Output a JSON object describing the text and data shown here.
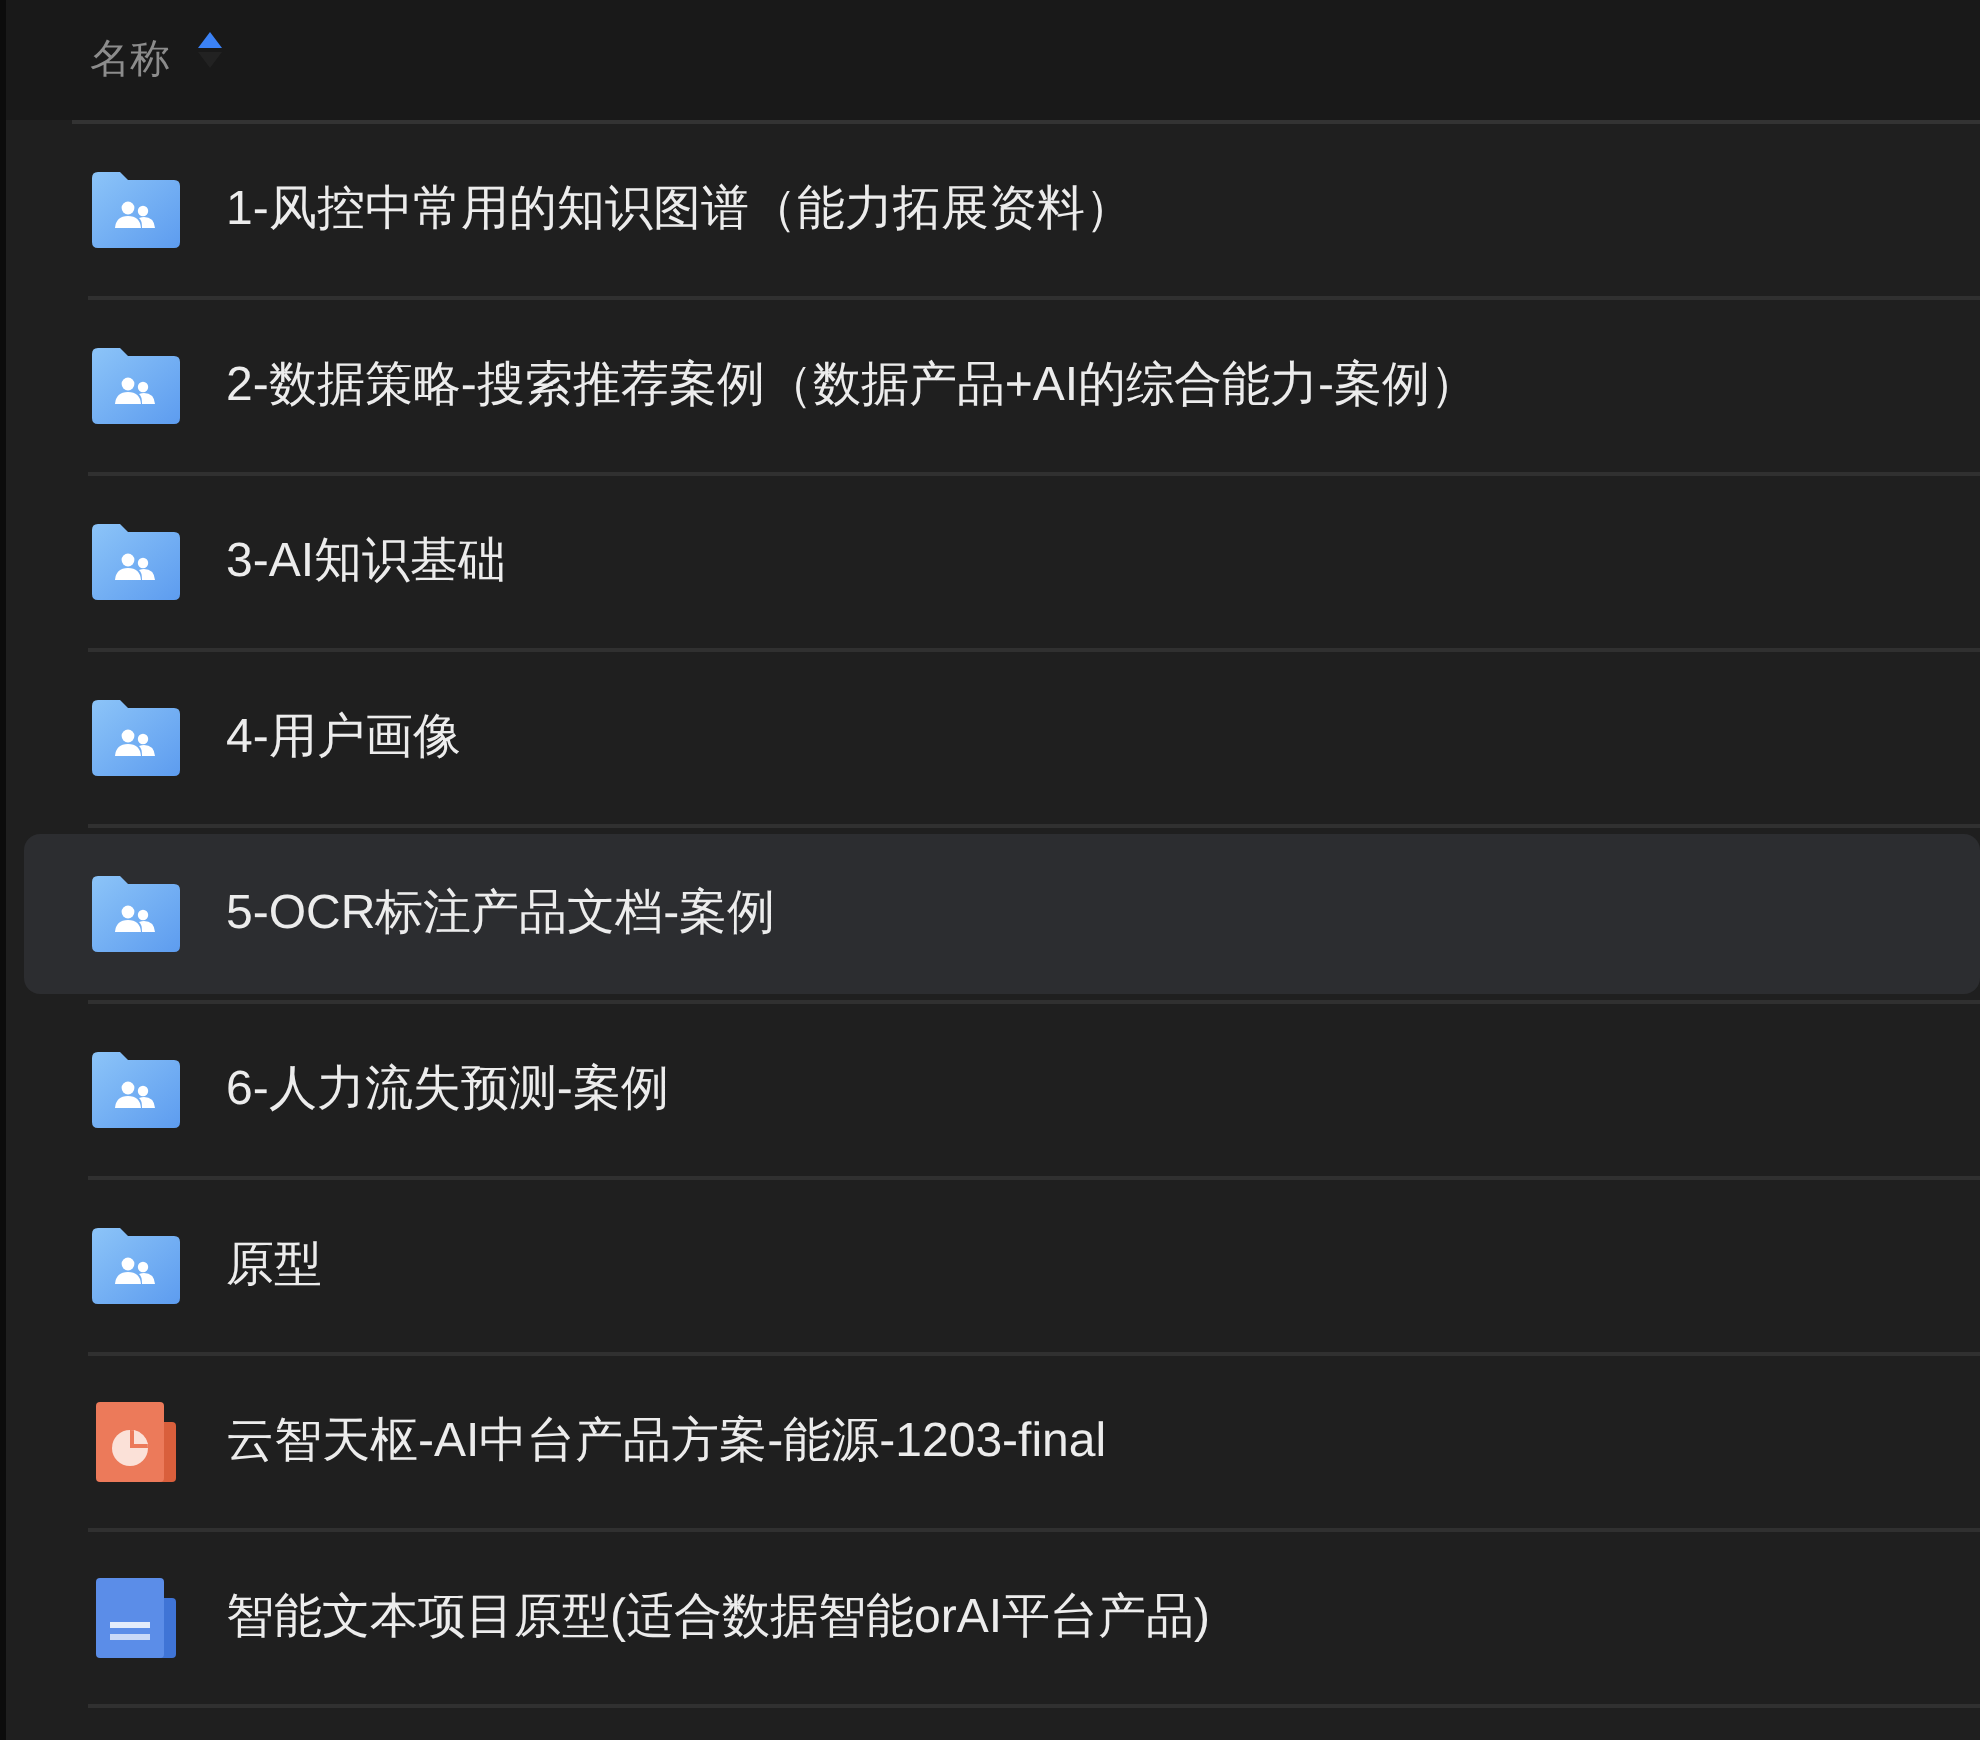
{
  "header": {
    "label": "名称",
    "sort_ascending": true
  },
  "files": [
    {
      "kind": "folder",
      "name": "1-风控中常用的知识图谱（能力拓展资料）",
      "selected": false
    },
    {
      "kind": "folder",
      "name": "2-数据策略-搜索推荐案例（数据产品+AI的综合能力-案例）",
      "selected": false
    },
    {
      "kind": "folder",
      "name": "3-AI知识基础",
      "selected": false
    },
    {
      "kind": "folder",
      "name": "4-用户画像",
      "selected": false
    },
    {
      "kind": "folder",
      "name": "5-OCR标注产品文档-案例",
      "selected": true
    },
    {
      "kind": "folder",
      "name": "6-人力流失预测-案例",
      "selected": false
    },
    {
      "kind": "folder",
      "name": "原型",
      "selected": false
    },
    {
      "kind": "presentation",
      "name": "云智天枢-AI中台产品方案-能源-1203-final",
      "selected": false
    },
    {
      "kind": "document",
      "name": "智能文本项目原型(适合数据智能orAI平台产品)",
      "selected": false
    }
  ]
}
